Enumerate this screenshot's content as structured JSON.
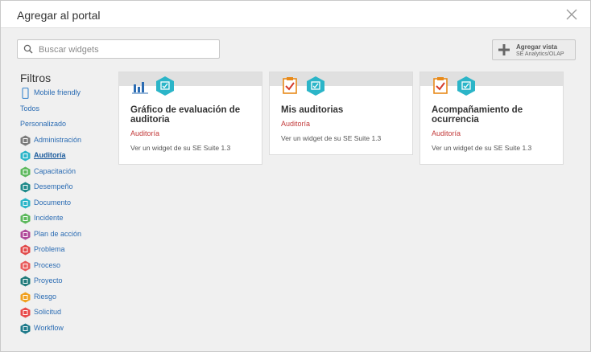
{
  "dialog": {
    "title": "Agregar al portal"
  },
  "search": {
    "placeholder": "Buscar widgets",
    "value": ""
  },
  "add_view": {
    "label": "Agregar vista",
    "sublabel": "SE Analytics/OLAP"
  },
  "filters": {
    "title": "Filtros",
    "items": [
      {
        "label": "Mobile friendly",
        "icon": "mobile-icon",
        "color": "#4a8fd0"
      },
      {
        "label": "Todos",
        "icon": "",
        "color": ""
      },
      {
        "label": "Personalizado",
        "icon": "",
        "color": ""
      },
      {
        "label": "Administración",
        "icon": "administracion-icon",
        "color": "#7a7a7a"
      },
      {
        "label": "Auditoría",
        "icon": "auditoria-icon",
        "color": "#2bb5c8",
        "active": true
      },
      {
        "label": "Capacitación",
        "icon": "capacitacion-icon",
        "color": "#5cb85c"
      },
      {
        "label": "Desempeño",
        "icon": "desempeno-icon",
        "color": "#1f8a8a"
      },
      {
        "label": "Documento",
        "icon": "documento-icon",
        "color": "#2bb5c8"
      },
      {
        "label": "Incidente",
        "icon": "incidente-icon",
        "color": "#5cb85c"
      },
      {
        "label": "Plan de acción",
        "icon": "plan-accion-icon",
        "color": "#b04a9a"
      },
      {
        "label": "Problema",
        "icon": "problema-icon",
        "color": "#e14a4a"
      },
      {
        "label": "Proceso",
        "icon": "proceso-icon",
        "color": "#e85a5a"
      },
      {
        "label": "Proyecto",
        "icon": "proyecto-icon",
        "color": "#1f7a7a"
      },
      {
        "label": "Riesgo",
        "icon": "riesgo-icon",
        "color": "#f0a020"
      },
      {
        "label": "Solicitud",
        "icon": "solicitud-icon",
        "color": "#e84a4a"
      },
      {
        "label": "Workflow",
        "icon": "workflow-icon",
        "color": "#1f7a8a"
      }
    ]
  },
  "cards": [
    {
      "title": "Gráfico de evaluación de auditoria",
      "category": "Auditoría",
      "description": "Ver un widget de su SE Suite 1.3",
      "icon": "bar-chart-icon"
    },
    {
      "title": "Mis auditorias",
      "category": "Auditoría",
      "description": "Ver un widget de su SE Suite 1.3",
      "icon": "clipboard-check-icon"
    },
    {
      "title": "Acompañamiento de ocurrencia",
      "category": "Auditoría",
      "description": "Ver un widget de su SE Suite 1.3",
      "icon": "clipboard-check-icon"
    }
  ],
  "colors": {
    "link": "#2b6cb3",
    "category": "#c23a3a",
    "module_hex": "#2bb5c8"
  }
}
